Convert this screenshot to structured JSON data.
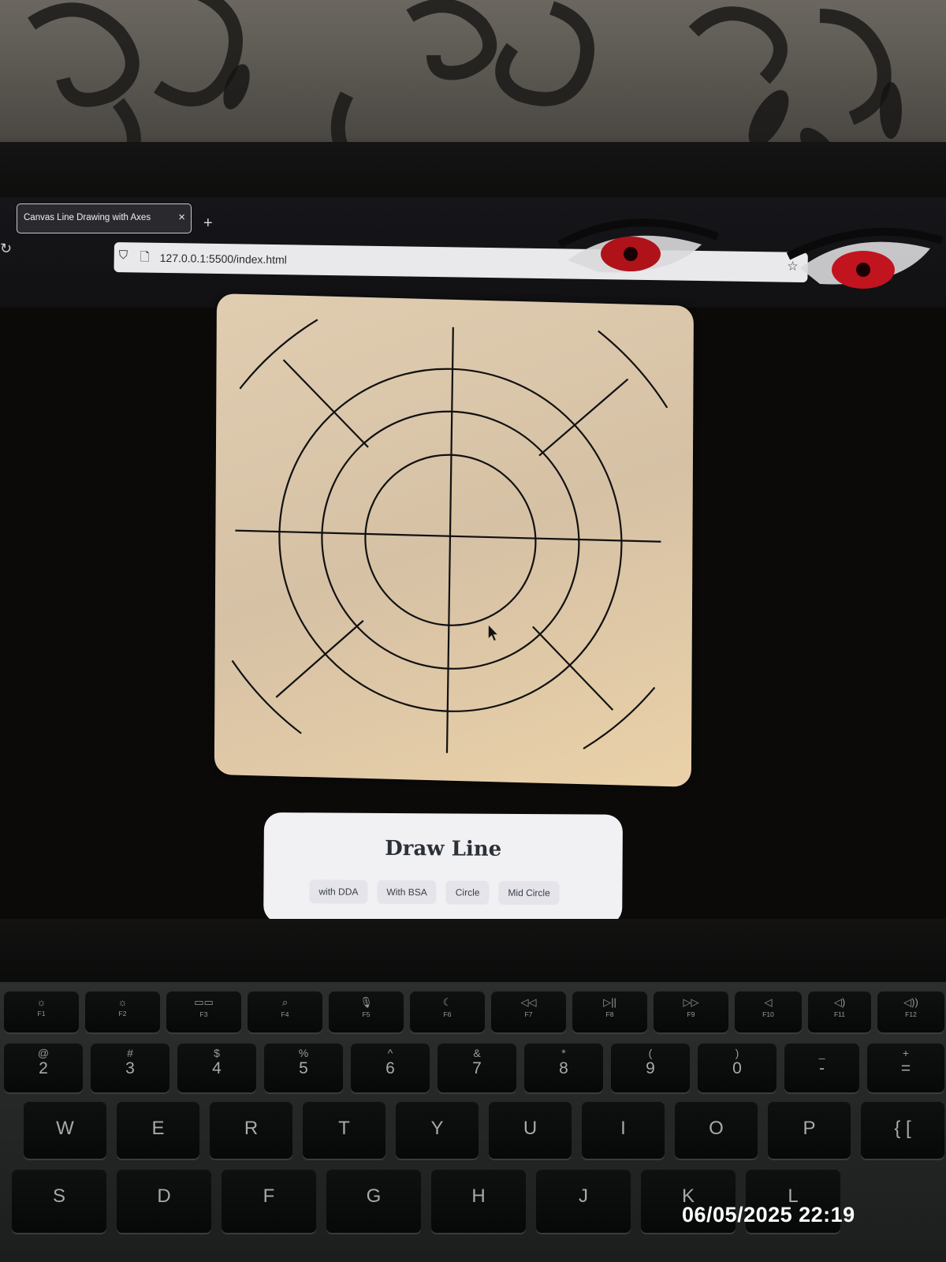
{
  "browser": {
    "tab_title": "Canvas Line Drawing with Axes",
    "tab_close": "×",
    "new_tab": "+",
    "reload_icon": "↻",
    "shield_icon": "⛉",
    "page_icon": "🗋",
    "url": "127.0.0.1:5500/index.html",
    "star_icon": "☆"
  },
  "panel": {
    "title": "Draw Line",
    "buttons": [
      "with DDA",
      "With BSA",
      "Circle",
      "Mid Circle"
    ]
  },
  "keyboard": {
    "function_row": [
      {
        "glyph": "☼",
        "label": "F1"
      },
      {
        "glyph": "☼",
        "label": "F2"
      },
      {
        "glyph": "▭▭",
        "label": "F3"
      },
      {
        "glyph": "⌕",
        "label": "F4"
      },
      {
        "glyph": "🎙",
        "label": "F5"
      },
      {
        "glyph": "☾",
        "label": "F6"
      },
      {
        "glyph": "◁◁",
        "label": "F7"
      },
      {
        "glyph": "▷||",
        "label": "F8"
      },
      {
        "glyph": "▷▷",
        "label": "F9"
      },
      {
        "glyph": "◁",
        "label": "F10"
      },
      {
        "glyph": "◁)",
        "label": "F11"
      },
      {
        "glyph": "◁))",
        "label": "F12"
      }
    ],
    "number_row": [
      {
        "top": "@",
        "main": "2"
      },
      {
        "top": "#",
        "main": "3"
      },
      {
        "top": "$",
        "main": "4"
      },
      {
        "top": "%",
        "main": "5"
      },
      {
        "top": "^",
        "main": "6"
      },
      {
        "top": "&",
        "main": "7"
      },
      {
        "top": "*",
        "main": "8"
      },
      {
        "top": "(",
        "main": "9"
      },
      {
        "top": ")",
        "main": "0"
      },
      {
        "top": "_",
        "main": "-"
      },
      {
        "top": "+",
        "main": "="
      }
    ],
    "qwerty_row": [
      "W",
      "E",
      "R",
      "T",
      "Y",
      "U",
      "I",
      "O",
      "P",
      "{ ["
    ],
    "home_row": [
      "S",
      "D",
      "F",
      "G",
      "H",
      "J",
      "K",
      "L"
    ]
  },
  "timestamp": "06/05/2025  22:19",
  "colors": {
    "canvas_background": "#d8c4a8",
    "stroke": "#111111",
    "panel_background": "#f1f1f4",
    "title_color": "#2c3138"
  }
}
